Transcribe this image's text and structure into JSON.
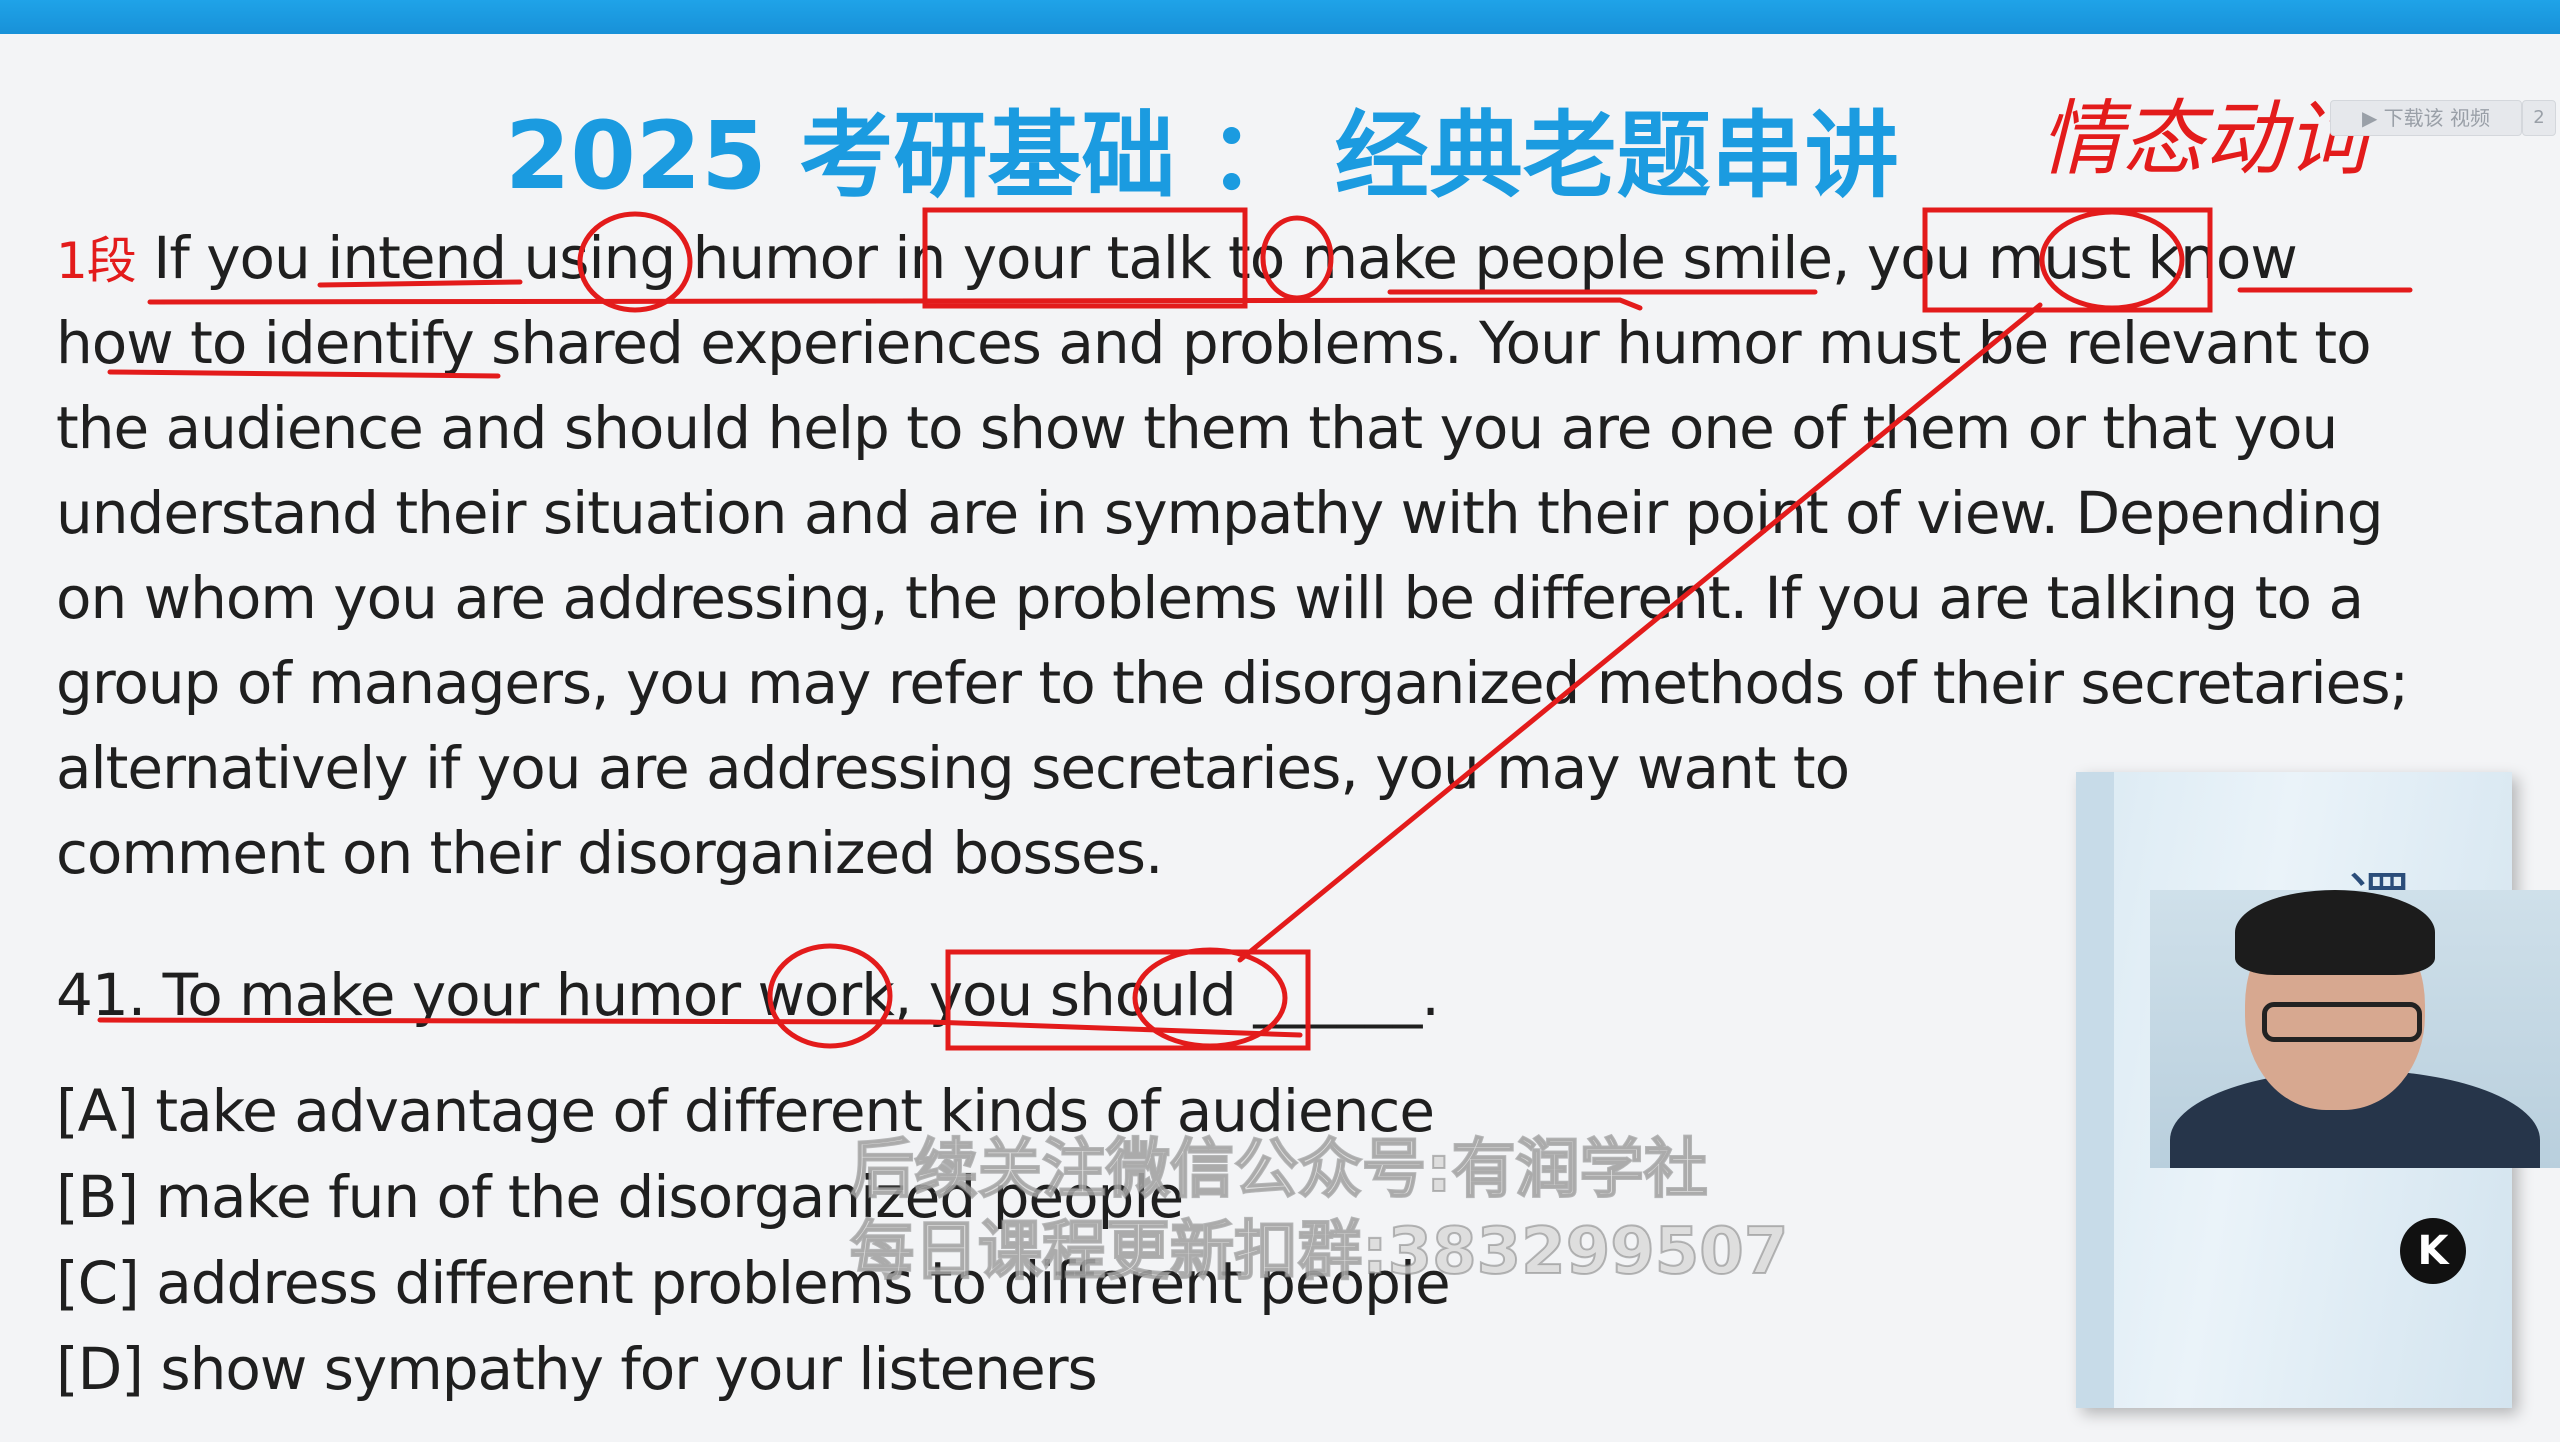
{
  "title": "2025 考研基础 ： 经典老题串讲",
  "handwritten_note": "情态动词",
  "download_button": "▶ 下载该 视频",
  "download_extra": "2",
  "passage": {
    "paragraph_marker": "1段",
    "lines": [
      "If you intend using humor in your talk to make people smile, you must know",
      "how to identify shared experiences and problems. Your humor must be relevant to",
      "the audience and should help to show them that you are one of them or that you",
      "understand their situation and are in sympathy with their point of view. Depending",
      "on whom you are addressing, the problems will be different. If you are talking to a",
      "group of managers, you may refer to the disorganized methods of their secretaries;",
      "alternatively if you are addressing secretaries, you may want to",
      "comment on their disorganized bosses."
    ]
  },
  "question": "41. To make your humor work, you should ______.",
  "options": [
    "[A] take advantage of different kinds of audience",
    "[B] make fun of the disorganized people",
    "[C] address different problems to different people",
    "[D] show sympathy for your listeners"
  ],
  "watermark": {
    "line1": "后续关注微信公众号:有润学社",
    "line2": "每日课程更新扣群:383299507"
  },
  "book_title": "逻",
  "logo_letter": "K",
  "colors": {
    "accent": "#1b9be0",
    "annotation": "#e31b1b"
  }
}
